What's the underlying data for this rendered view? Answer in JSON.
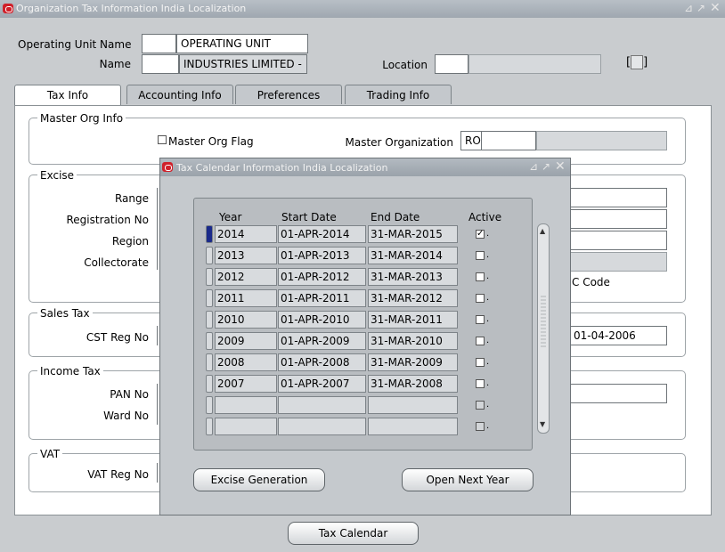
{
  "window": {
    "title": "Organization Tax Information India Localization"
  },
  "header": {
    "operating_unit_label": "Operating Unit Name",
    "operating_unit_value": "OPERATING UNIT",
    "name_label": "Name",
    "name_value": "INDUSTRIES LIMITED -",
    "location_label": "Location",
    "location_value": ""
  },
  "tabs": [
    {
      "label": "Tax Info",
      "active": true
    },
    {
      "label": "Accounting  Info",
      "active": false
    },
    {
      "label": "Preferences",
      "active": false
    },
    {
      "label": "Trading Info",
      "active": false
    }
  ],
  "master_org": {
    "group_title": "Master Org Info",
    "flag_label": "Master Org Flag",
    "master_org_label": "Master Organization",
    "master_org_value": "RO"
  },
  "excise": {
    "group_title": "Excise",
    "range_label": "Range",
    "registration_label": "Registration No",
    "region_label": "Region",
    "collectorate_label": "Collectorate",
    "ec_code_fragment": "C Code"
  },
  "sales_tax": {
    "group_title": "Sales Tax",
    "cst_label": "CST Reg No",
    "date_value": "01-04-2006"
  },
  "income_tax": {
    "group_title": "Income Tax",
    "pan_label": "PAN No",
    "ward_label": "Ward No"
  },
  "vat": {
    "group_title": "VAT",
    "vat_label": "VAT Reg No"
  },
  "footer": {
    "tax_calendar_button": "Tax Calendar"
  },
  "dialog": {
    "title": "Tax Calendar Information India Localization",
    "columns": [
      "Year",
      "Start Date",
      "End Date",
      "Active"
    ],
    "rows": [
      {
        "year": "2014",
        "start": "01-APR-2014",
        "end": "31-MAR-2015",
        "active": true
      },
      {
        "year": "2013",
        "start": "01-APR-2013",
        "end": "31-MAR-2014",
        "active": false
      },
      {
        "year": "2012",
        "start": "01-APR-2012",
        "end": "31-MAR-2013",
        "active": false
      },
      {
        "year": "2011",
        "start": "01-APR-2011",
        "end": "31-MAR-2012",
        "active": false
      },
      {
        "year": "2010",
        "start": "01-APR-2010",
        "end": "31-MAR-2011",
        "active": false
      },
      {
        "year": "2009",
        "start": "01-APR-2009",
        "end": "31-MAR-2010",
        "active": false
      },
      {
        "year": "2008",
        "start": "01-APR-2008",
        "end": "31-MAR-2009",
        "active": false
      },
      {
        "year": "2007",
        "start": "01-APR-2007",
        "end": "31-MAR-2008",
        "active": false
      },
      {
        "year": "",
        "start": "",
        "end": "",
        "active": false
      },
      {
        "year": "",
        "start": "",
        "end": "",
        "active": false
      }
    ],
    "excise_generation_button": "Excise Generation",
    "open_next_year_button": "Open Next Year"
  },
  "icons": {
    "window_controls": [
      "minimize-icon",
      "maximize-icon",
      "close-icon"
    ],
    "app": "oracle-icon"
  },
  "colors": {
    "brand": "#d0202a",
    "current_record": "#1a2a8a"
  }
}
